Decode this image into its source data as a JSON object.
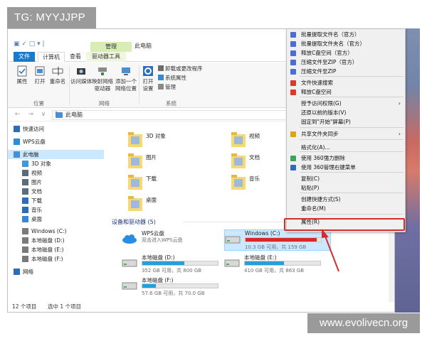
{
  "watermarks": {
    "top": "TG: MYYJJPP",
    "bottom": "www.evolivecn.org"
  },
  "window": {
    "title": "此电脑",
    "manage_tab": "管理"
  },
  "tabs": {
    "file": "文件",
    "computer": "计算机",
    "view": "查看",
    "drive_tools": "驱动器工具"
  },
  "ribbon": {
    "location": {
      "label": "位置",
      "items": [
        "属性",
        "打开",
        "重命名"
      ]
    },
    "network": {
      "label": "网络",
      "access_media": "访问媒体",
      "map_drive_1": "映射网络",
      "map_drive_2": "驱动器",
      "add_location_1": "添加一个",
      "add_location_2": "网络位置"
    },
    "system": {
      "label": "系统",
      "open_settings_1": "打开",
      "open_settings_2": "设置",
      "uninstall": "卸载或更改程序",
      "system_properties": "系统属性",
      "manage": "管理"
    }
  },
  "address": {
    "path": "此电脑",
    "nav": "←  →  ∨  ↑"
  },
  "nav_pane": {
    "items": [
      {
        "label": "快速访问",
        "icon": "star-icon",
        "color": "#2a6ebb"
      },
      {
        "label": "WPS云盘",
        "icon": "cloud-icon",
        "color": "#2a8de0"
      },
      {
        "label": "此电脑",
        "icon": "computer-icon",
        "color": "#4a8ed6"
      },
      {
        "label": "3D 对象",
        "icon": "cube-icon",
        "color": "#3c9ad8"
      },
      {
        "label": "视频",
        "icon": "video-icon",
        "color": "#5a6b80"
      },
      {
        "label": "图片",
        "icon": "picture-icon",
        "color": "#5a6b80"
      },
      {
        "label": "文档",
        "icon": "document-icon",
        "color": "#5a6b80"
      },
      {
        "label": "下载",
        "icon": "download-icon",
        "color": "#2a6ebb"
      },
      {
        "label": "音乐",
        "icon": "music-icon",
        "color": "#2a6ebb"
      },
      {
        "label": "桌面",
        "icon": "desktop-icon",
        "color": "#3a86d0"
      },
      {
        "label": "Windows (C:)",
        "icon": "drive-icon",
        "color": "#7a7a7a"
      },
      {
        "label": "本地磁盘 (D:)",
        "icon": "drive-icon",
        "color": "#7a7a7a"
      },
      {
        "label": "本地磁盘 (E:)",
        "icon": "drive-icon",
        "color": "#7a7a7a"
      },
      {
        "label": "本地磁盘 (F:)",
        "icon": "drive-icon",
        "color": "#7a7a7a"
      },
      {
        "label": "网络",
        "icon": "network-icon",
        "color": "#2a6ebb"
      }
    ]
  },
  "folders": [
    {
      "label": "3D 对象"
    },
    {
      "label": "视频"
    },
    {
      "label": "图片"
    },
    {
      "label": "文档"
    },
    {
      "label": "下载"
    },
    {
      "label": "音乐"
    },
    {
      "label": "桌面"
    }
  ],
  "devices": {
    "header": "设备和驱动器 (5)",
    "wps": {
      "name": "WPS云盘",
      "sub": "双击进入WPS云盘"
    },
    "drives": [
      {
        "name": "Windows (C:)",
        "info": "10.3 GB 可用，共 159 GB",
        "used_fraction": 0.94,
        "bar_color": "#da2626"
      },
      {
        "name": "本地磁盘 (D:)",
        "info": "352 GB 可用，共 800 GB",
        "used_fraction": 0.56,
        "bar_color": "#26a0da"
      },
      {
        "name": "本地磁盘 (E:)",
        "info": "410 GB 可用，共 863 GB",
        "used_fraction": 0.52,
        "bar_color": "#26a0da"
      },
      {
        "name": "本地磁盘 (F:)",
        "info": "57.6 GB 可用，共 70.0 GB",
        "used_fraction": 0.18,
        "bar_color": "#26a0da"
      }
    ]
  },
  "status": {
    "count": "12 个项目",
    "selected": "选中 1 个项目"
  },
  "context_menu": {
    "items": [
      {
        "label": "批量提取文件名（官方）",
        "icon_color": "#4a6fd0"
      },
      {
        "label": "批量提取文件夹名（官方）",
        "icon_color": "#4a6fd0"
      },
      {
        "label": "释放C盘空间（官方）",
        "icon_color": "#4a6fd0"
      },
      {
        "label": "压缩文件至ZIP（官方）",
        "icon_color": "#4a6fd0"
      },
      {
        "label": "压缩文件至ZIP",
        "icon_color": "#4a6fd0"
      },
      {
        "label": "文件快速搜索",
        "icon_color": "#d83b2b"
      },
      {
        "label": "释放C盘空间",
        "icon_color": "#d83b2b"
      },
      {
        "label": "授予访问权限(G)",
        "icon_color": "",
        "submenu": true
      },
      {
        "label": "还原以前的版本(V)",
        "icon_color": ""
      },
      {
        "label": "固定到\"开始\"屏幕(P)",
        "icon_color": ""
      },
      {
        "label": "共享文件夹同步",
        "icon_color": "#e0a020",
        "submenu": true
      },
      {
        "label": "格式化(A)...",
        "icon_color": ""
      },
      {
        "label": "使用 360强力删除",
        "icon_color": "#3aa65a"
      },
      {
        "label": "使用 360管理右键菜单",
        "icon_color": "#2a6ebb"
      },
      {
        "label": "复制(C)",
        "icon_color": ""
      },
      {
        "label": "粘贴(P)",
        "icon_color": ""
      },
      {
        "label": "创建快捷方式(S)",
        "icon_color": ""
      },
      {
        "label": "重命名(M)",
        "icon_color": ""
      },
      {
        "label": "属性(R)",
        "icon_color": ""
      }
    ],
    "highlight_color": "#d12d2d"
  }
}
